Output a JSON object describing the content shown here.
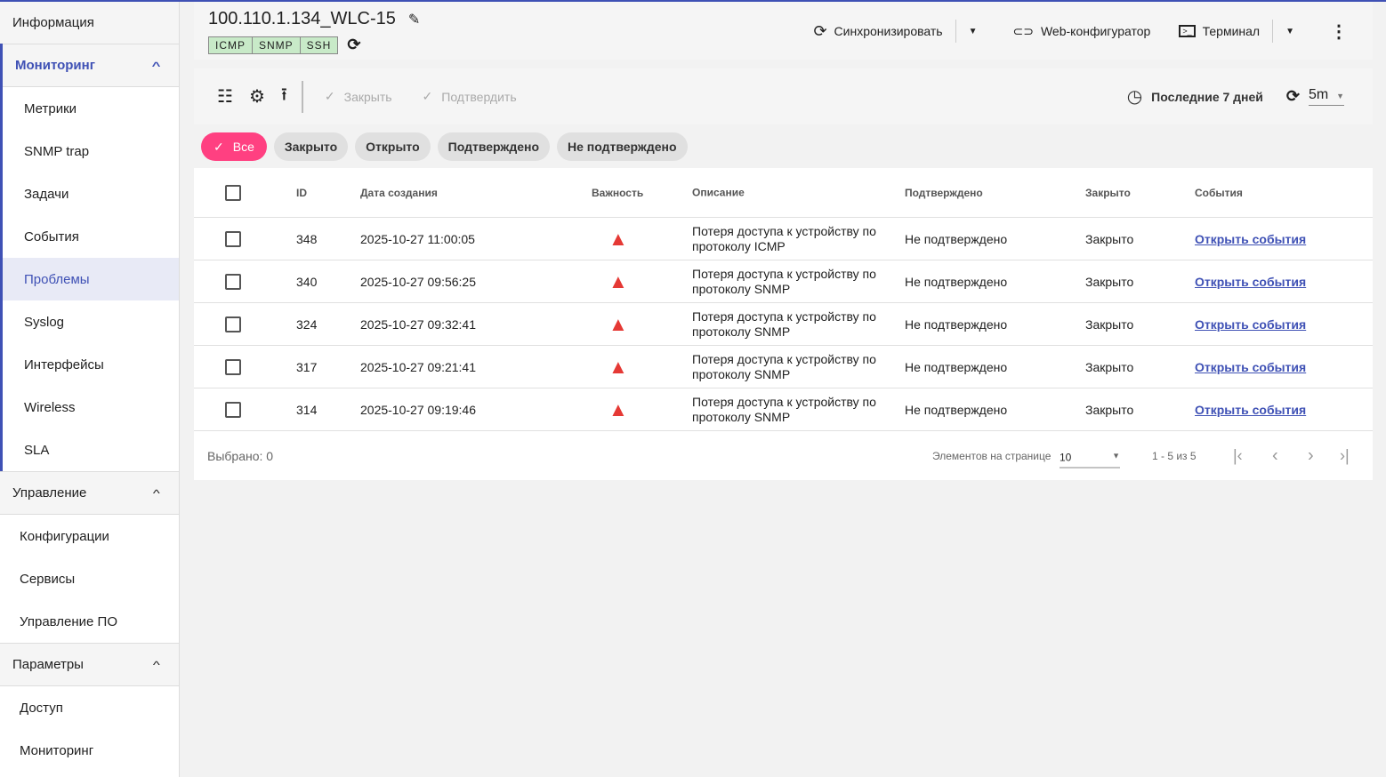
{
  "sidebar": {
    "info": "Информация",
    "monitoring": {
      "label": "Мониторинг",
      "items": [
        "Метрики",
        "SNMP trap",
        "Задачи",
        "События",
        "Проблемы",
        "Syslog",
        "Интерфейсы",
        "Wireless",
        "SLA"
      ]
    },
    "management": {
      "label": "Управление",
      "items": [
        "Конфигурации",
        "Сервисы",
        "Управление ПО"
      ]
    },
    "params": {
      "label": "Параметры",
      "items": [
        "Доступ",
        "Мониторинг"
      ]
    }
  },
  "header": {
    "title": "100.110.1.134_WLC-15",
    "tags": [
      "ICMP",
      "SNMP",
      "SSH"
    ],
    "sync": "Синхронизировать",
    "web": "Web-конфигуратор",
    "terminal": "Терминал"
  },
  "toolbar": {
    "close": "Закрыть",
    "confirm": "Подтвердить",
    "period": "Последние 7 дней",
    "refresh": "5m"
  },
  "chips": [
    "Все",
    "Закрыто",
    "Открыто",
    "Подтверждено",
    "Не подтверждено"
  ],
  "table": {
    "columns": [
      "ID",
      "Дата создания",
      "Важность",
      "Описание",
      "Подтверждено",
      "Закрыто",
      "События"
    ],
    "rows": [
      {
        "id": "348",
        "date": "2025-10-27 11:00:05",
        "desc": "Потеря доступа к устройству по протоколу ICMP",
        "confirmed": "Не подтверждено",
        "closed": "Закрыто",
        "events": "Открыть события"
      },
      {
        "id": "340",
        "date": "2025-10-27 09:56:25",
        "desc": "Потеря доступа к устройству по протоколу SNMP",
        "confirmed": "Не подтверждено",
        "closed": "Закрыто",
        "events": "Открыть события"
      },
      {
        "id": "324",
        "date": "2025-10-27 09:32:41",
        "desc": "Потеря доступа к устройству по протоколу SNMP",
        "confirmed": "Не подтверждено",
        "closed": "Закрыто",
        "events": "Открыть события"
      },
      {
        "id": "317",
        "date": "2025-10-27 09:21:41",
        "desc": "Потеря доступа к устройству по протоколу SNMP",
        "confirmed": "Не подтверждено",
        "closed": "Закрыто",
        "events": "Открыть события"
      },
      {
        "id": "314",
        "date": "2025-10-27 09:19:46",
        "desc": "Потеря доступа к устройству по протоколу SNMP",
        "confirmed": "Не подтверждено",
        "closed": "Закрыто",
        "events": "Открыть события"
      }
    ]
  },
  "footer": {
    "selected": "Выбрано: 0",
    "per_page_label": "Элементов на странице",
    "per_page": "10",
    "range": "1 - 5 из 5"
  }
}
